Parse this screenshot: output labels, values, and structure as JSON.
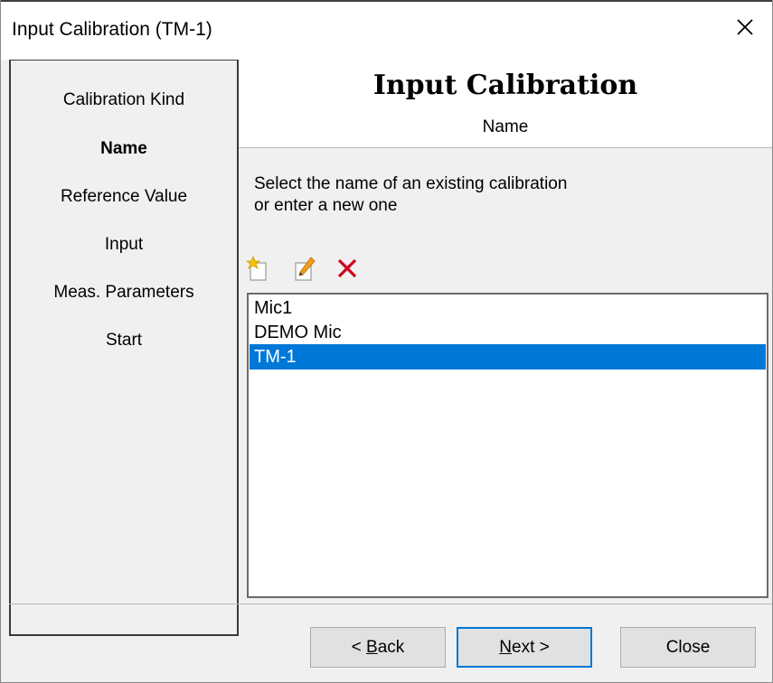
{
  "window": {
    "title": "Input Calibration (TM-1)"
  },
  "steps": [
    "Calibration Kind",
    "Name",
    "Reference Value",
    "Input",
    "Meas. Parameters",
    "Start"
  ],
  "active_step": "Name",
  "header": {
    "title": "Input Calibration",
    "subtitle": "Name"
  },
  "instructions": {
    "line1": "Select the name of an existing calibration",
    "line2": "or enter a new one"
  },
  "toolbar": {
    "icons": [
      "new-icon",
      "edit-icon",
      "delete-icon"
    ]
  },
  "list": {
    "items": [
      "Mic1",
      "DEMO Mic",
      "TM-1"
    ],
    "selected": "TM-1"
  },
  "buttons": {
    "back": {
      "prefix": "< ",
      "mnemonic": "B",
      "rest": "ack"
    },
    "next": {
      "mnemonic": "N",
      "rest": "ext >"
    },
    "close": "Close"
  },
  "colors": {
    "selection": "#0078d7",
    "delete": "#d0021b",
    "new_star": "#f5c400"
  }
}
